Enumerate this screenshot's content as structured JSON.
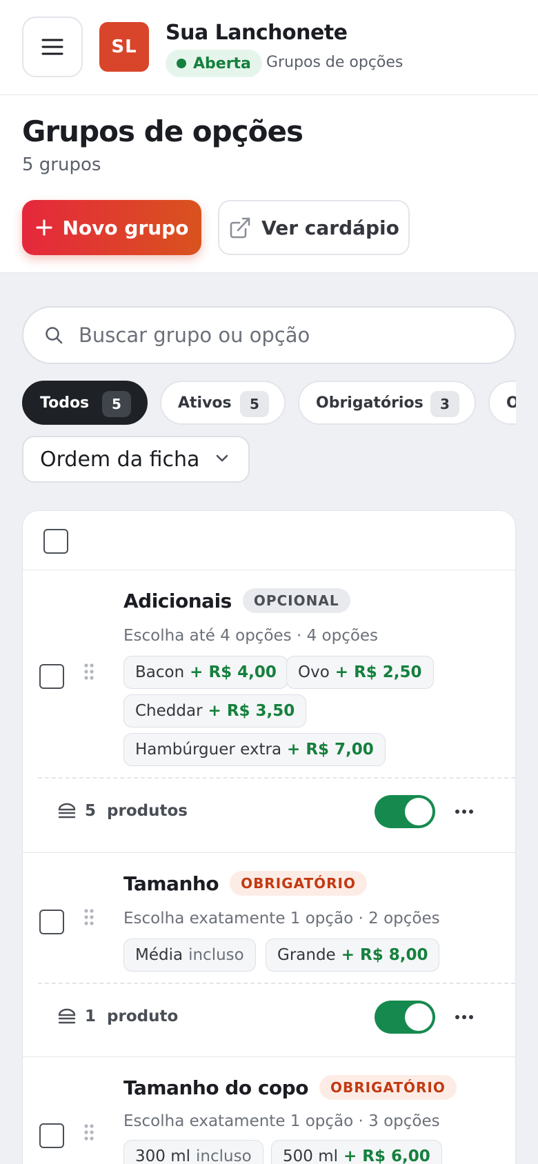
{
  "header": {
    "logo_initials": "SL",
    "store_name": "Sua Lanchonete",
    "status": "Aberta",
    "breadcrumb": "Grupos de opções"
  },
  "page": {
    "title": "Grupos de opções",
    "subtitle": "5 grupos",
    "new_button": "Novo grupo",
    "view_button": "Ver cardápio"
  },
  "search": {
    "placeholder": "Buscar grupo ou opção",
    "value": ""
  },
  "filters": [
    {
      "label": "Todos",
      "count": "5",
      "active": true
    },
    {
      "label": "Ativos",
      "count": "5"
    },
    {
      "label": "Obrigatórios",
      "count": "3"
    },
    {
      "label": "O"
    }
  ],
  "sort": {
    "selected": "Ordem da ficha"
  },
  "colors": {
    "accent": "#e5283c",
    "success": "#15803d",
    "dark": "#1e2126"
  },
  "groups": [
    {
      "title": "Adicionais",
      "badge": "OPCIONAL",
      "subtitle": "Escolha até 4 opções · 4 opções",
      "options": [
        {
          "name": "Bacon",
          "price": "+ R$ 4,00"
        },
        {
          "name": "Ovo",
          "price": "+ R$ 2,50"
        },
        {
          "name": "Cheddar",
          "price": "+ R$ 3,50"
        },
        {
          "name": "Hambúrguer extra",
          "price": "+ R$ 7,00"
        }
      ],
      "product_count": "5",
      "product_label": "produtos"
    },
    {
      "title": "Tamanho",
      "badge": "OBRIGATÓRIO",
      "subtitle": "Escolha exatamente 1 opção · 2 opções",
      "options": [
        {
          "name": "Média",
          "note": "incluso"
        },
        {
          "name": "Grande",
          "price": "+ R$ 8,00"
        }
      ],
      "product_count": "1",
      "product_label": "produto"
    },
    {
      "title": "Tamanho do copo",
      "badge": "OBRIGATÓRIO",
      "subtitle": "Escolha exatamente 1 opção · 3 opções",
      "options": [
        {
          "name": "300 ml",
          "note": "incluso"
        },
        {
          "name": "500 ml",
          "price": "+ R$ 6,00"
        }
      ]
    }
  ]
}
